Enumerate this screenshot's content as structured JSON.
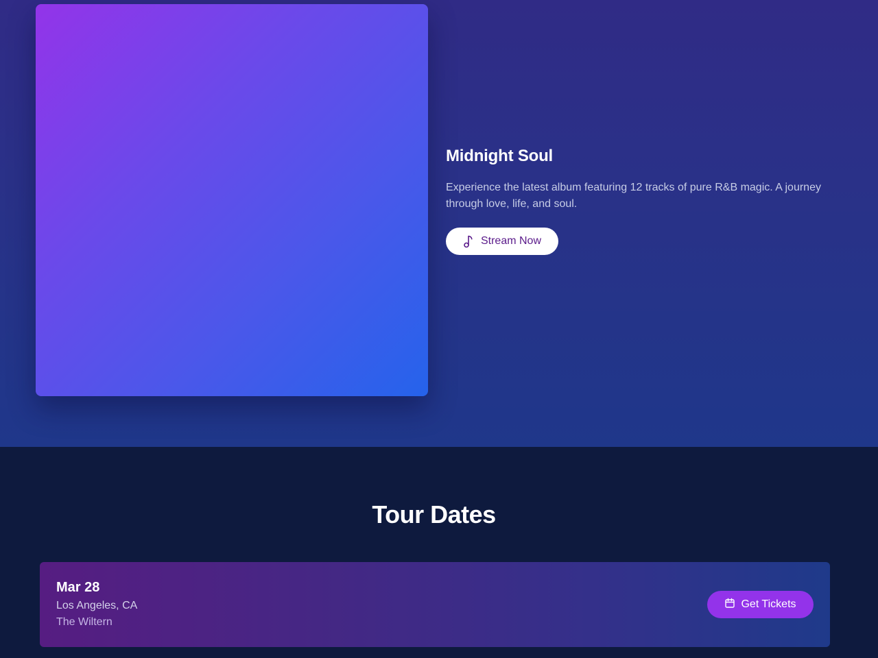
{
  "album": {
    "title": "Midnight Soul",
    "description": "Experience the latest album featuring 12 tracks of pure R&B magic. A journey through love, life, and soul.",
    "stream_label": "Stream Now",
    "stream_icon": "music-note-icon"
  },
  "tour": {
    "heading": "Tour Dates",
    "events": [
      {
        "date": "Mar 28",
        "city": "Los Angeles, CA",
        "venue": "The Wiltern",
        "button_label": "Get Tickets",
        "button_icon": "calendar-icon"
      }
    ]
  },
  "colors": {
    "accent": "#9333ea",
    "hero_bg": "#2a3188",
    "section_bg": "#0e1a3e"
  }
}
